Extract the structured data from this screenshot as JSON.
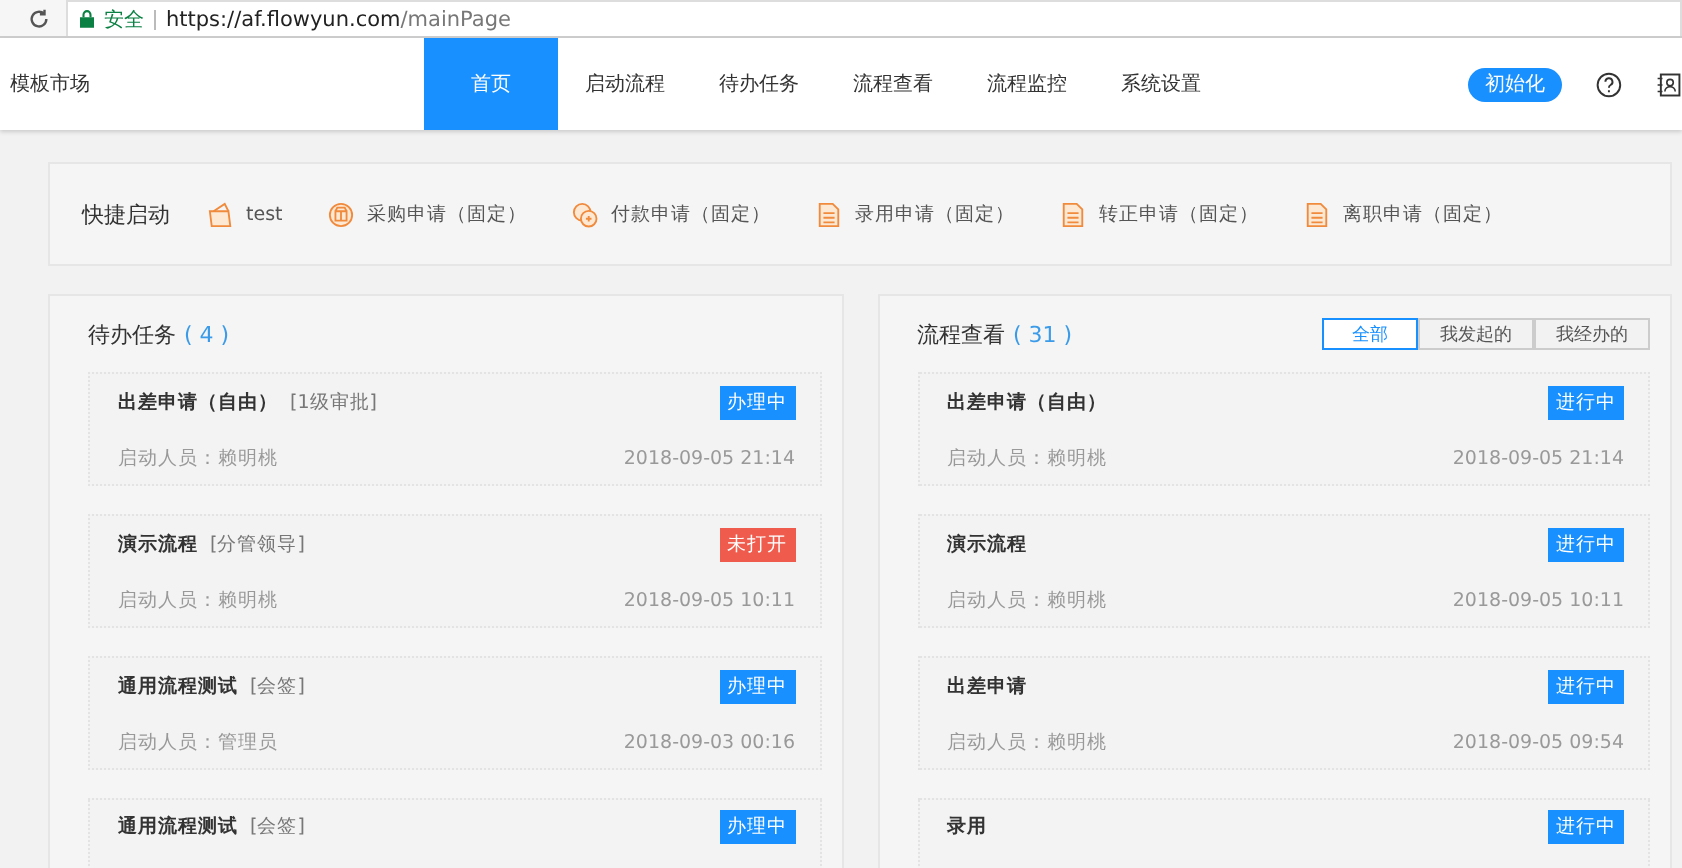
{
  "browser": {
    "security": "安全",
    "url_host": "https://af.flowyun.com",
    "url_path": "/mainPage"
  },
  "header": {
    "brand": "模板市场",
    "nav": [
      {
        "label": "首页",
        "selected": true
      },
      {
        "label": "启动流程",
        "selected": false
      },
      {
        "label": "待办任务",
        "selected": false
      },
      {
        "label": "流程查看",
        "selected": false
      },
      {
        "label": "流程监控",
        "selected": false
      },
      {
        "label": "系统设置",
        "selected": false
      }
    ],
    "init_button": "初始化"
  },
  "quick_start": {
    "title": "快捷启动",
    "items": [
      {
        "kind": "folder",
        "label": "test"
      },
      {
        "kind": "shop",
        "label": "采购申请（固定）"
      },
      {
        "kind": "coin",
        "label": "付款申请（固定）"
      },
      {
        "kind": "doc",
        "label": "录用申请（固定）"
      },
      {
        "kind": "doc",
        "label": "转正申请（固定）"
      },
      {
        "kind": "doc",
        "label": "离职申请（固定）"
      }
    ]
  },
  "todo": {
    "title": "待办任务",
    "count": "( 4 )",
    "items": [
      {
        "name": "出差申请（自由）",
        "step": "[1级审批]",
        "status": "办理中",
        "color": "#1890ff",
        "starter": "启动人员：赖明桃",
        "time": "2018-09-05 21:14"
      },
      {
        "name": "演示流程",
        "step": "[分管领导]",
        "status": "未打开",
        "color": "#ef5b4c",
        "starter": "启动人员：赖明桃",
        "time": "2018-09-05 10:11"
      },
      {
        "name": "通用流程测试",
        "step": "[会签]",
        "status": "办理中",
        "color": "#1890ff",
        "starter": "启动人员：管理员",
        "time": "2018-09-03 00:16"
      },
      {
        "name": "通用流程测试",
        "step": "[会签]",
        "status": "办理中",
        "color": "#1890ff"
      }
    ]
  },
  "flows": {
    "title": "流程查看",
    "count": "( 31 )",
    "filters": [
      {
        "label": "全部",
        "selected": true
      },
      {
        "label": "我发起的",
        "selected": false
      },
      {
        "label": "我经办的",
        "selected": false
      }
    ],
    "items": [
      {
        "name": "出差申请（自由）",
        "status": "进行中",
        "starter": "启动人员：赖明桃",
        "time": "2018-09-05 21:14"
      },
      {
        "name": "演示流程",
        "status": "进行中",
        "starter": "启动人员：赖明桃",
        "time": "2018-09-05 10:11"
      },
      {
        "name": "出差申请",
        "status": "进行中",
        "starter": "启动人员：赖明桃",
        "time": "2018-09-05 09:54"
      },
      {
        "name": "录用",
        "status": "进行中"
      }
    ]
  }
}
